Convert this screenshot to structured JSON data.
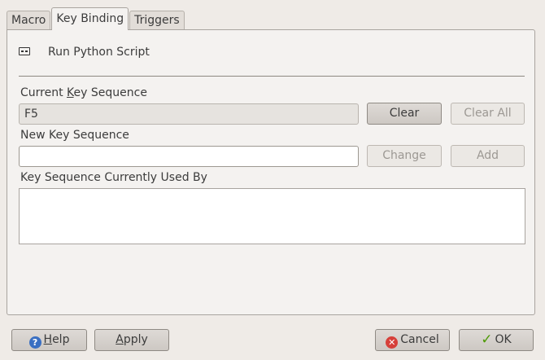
{
  "tabs": [
    {
      "label": "Macro"
    },
    {
      "label": "Key Binding"
    },
    {
      "label": "Triggers"
    }
  ],
  "action": {
    "icon": "script-icon",
    "label": "Run Python Script"
  },
  "current": {
    "label_pre": "Current ",
    "label_mnemonic": "K",
    "label_post": "ey Sequence",
    "value": "F5",
    "clear_label": "Clear",
    "clear_all_label": "Clear All"
  },
  "new_seq": {
    "label": "New Key Sequence",
    "value": "",
    "change_label": "Change",
    "add_label": "Add"
  },
  "used_by": {
    "label": "Key Sequence Currently Used By"
  },
  "footer": {
    "help_mnemonic": "H",
    "help_rest": "elp",
    "apply_mnemonic": "A",
    "apply_rest": "pply",
    "cancel_label": "Cancel",
    "ok_label": "OK"
  }
}
